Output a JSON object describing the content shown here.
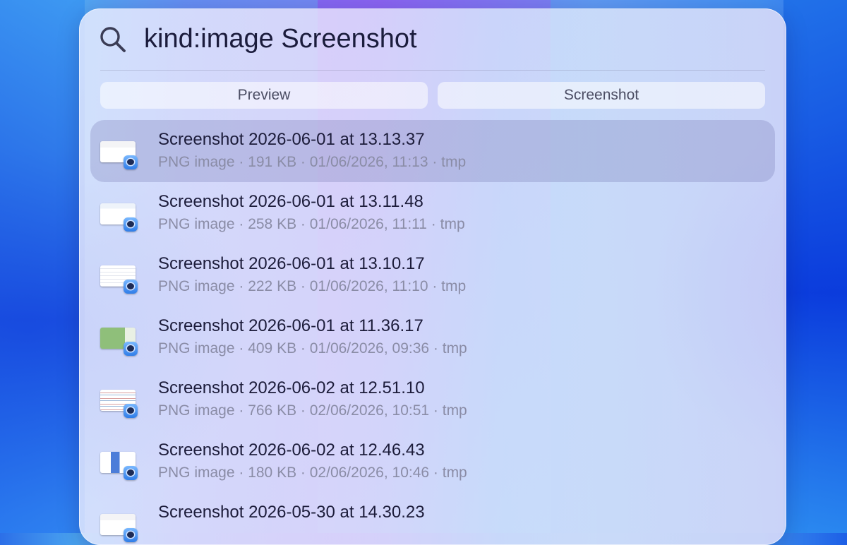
{
  "search": {
    "query": "kind:image Screenshot"
  },
  "filters": [
    {
      "label": "Preview"
    },
    {
      "label": "Screenshot"
    }
  ],
  "results": [
    {
      "title": "Screenshot 2026-06-01 at 13.13.37",
      "meta": "PNG image · 191 KB · 01/06/2026, 11:13 · tmp",
      "selected": true,
      "thumb": "plain"
    },
    {
      "title": "Screenshot 2026-06-01 at 13.11.48",
      "meta": "PNG image · 258 KB · 01/06/2026, 11:11 · tmp",
      "selected": false,
      "thumb": "chart"
    },
    {
      "title": "Screenshot 2026-06-01 at 13.10.17",
      "meta": "PNG image · 222 KB · 01/06/2026, 11:10 · tmp",
      "selected": false,
      "thumb": "text"
    },
    {
      "title": "Screenshot 2026-06-01 at 11.36.17",
      "meta": "PNG image · 409 KB · 01/06/2026, 09:36 · tmp",
      "selected": false,
      "thumb": "green"
    },
    {
      "title": "Screenshot 2026-06-02 at 12.51.10",
      "meta": "PNG image · 766 KB · 02/06/2026, 10:51 · tmp",
      "selected": false,
      "thumb": "table"
    },
    {
      "title": "Screenshot 2026-06-02 at 12.46.43",
      "meta": "PNG image · 180 KB · 02/06/2026, 10:46 · tmp",
      "selected": false,
      "thumb": "blue"
    },
    {
      "title": "Screenshot 2026-05-30 at 14.30.23",
      "meta": "",
      "selected": false,
      "thumb": "plain"
    }
  ],
  "icons": {
    "search": "search-icon",
    "file_badge": "preview-app-icon"
  }
}
